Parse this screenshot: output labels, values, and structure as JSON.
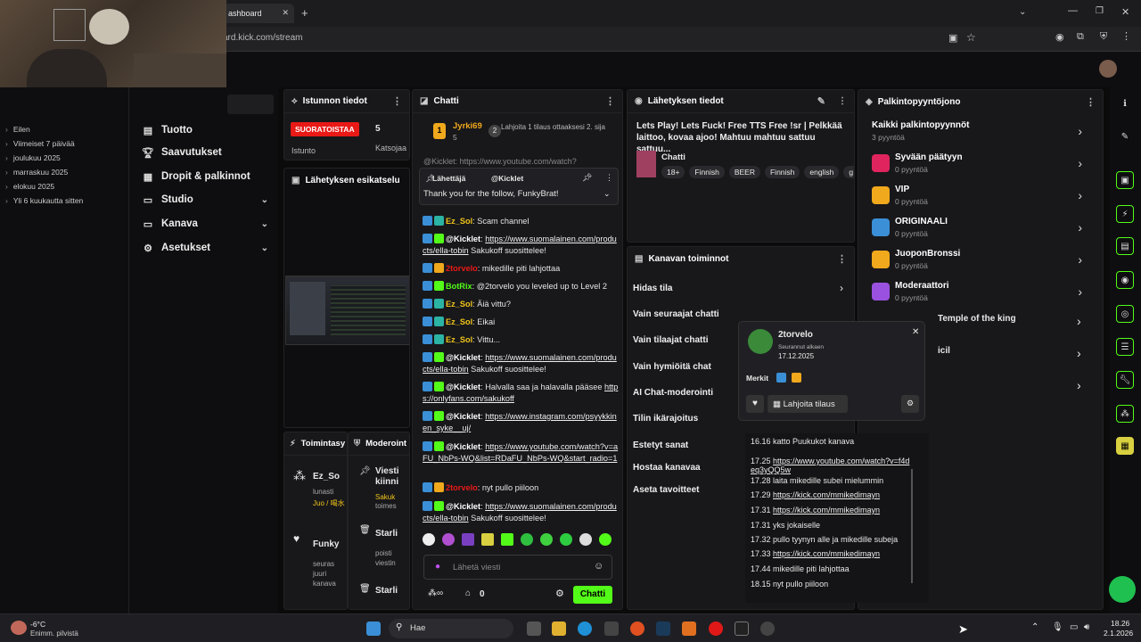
{
  "browser": {
    "tab_title": "ashboard",
    "url": "ard.kick.com/stream"
  },
  "history": [
    "Eilen",
    "Viimeiset 7 päivää",
    "joulukuu 2025",
    "marraskuu 2025",
    "elokuu 2025",
    "Yli 6 kuukautta sitten"
  ],
  "sidenav": {
    "items": [
      {
        "label": "Tuotto",
        "icon": "chart-icon"
      },
      {
        "label": "Saavutukset",
        "icon": "trophy-icon"
      },
      {
        "label": "Dropit & palkinnot",
        "icon": "gift-icon"
      },
      {
        "label": "Studio",
        "icon": "video-icon"
      },
      {
        "label": "Kanava",
        "icon": "broadcast-icon"
      },
      {
        "label": "Asetukset",
        "icon": "gear-icon"
      }
    ]
  },
  "session": {
    "title": "Istunnon tiedot",
    "live_badge": "SUORATOISTAA",
    "viewers": "5",
    "duration_label": "Istunto",
    "watching_label": "Katsojaa"
  },
  "preview": {
    "title": "Lähetyksen esikatselu"
  },
  "actions_panel": {
    "title": "Toimintasy"
  },
  "mod_panel": {
    "title": "Moderoint"
  },
  "activity": [
    {
      "user": "Ez_So",
      "sub": "lunasti",
      "extra": "Juo / 喝水"
    },
    {
      "user": "Viesti kiinni",
      "sub": "Sakuk",
      "extra": "toimes"
    },
    {
      "user": "Funky",
      "sub": "seuras juuri kanava"
    },
    {
      "user": "Starli",
      "sub": "poisti viestin"
    },
    {
      "user": "Starli",
      "sub": ""
    }
  ],
  "chat": {
    "title": "Chatti",
    "top_gifter": "Jyrki69",
    "top_gifter_count": "5",
    "gift_prompt": "Lahjoita 1 tilaus ottaaksesi 2. sija",
    "pinned_sender": "Lähettäjä",
    "pinned_user": "@Kicklet",
    "pinned_text": "Thank you for the follow, FunkyBrat!",
    "ghost_line": "@Kicklet: https://www.youtube.com/watch?",
    "messages": [
      {
        "user": "Ez_Sol",
        "color": "#f0c419",
        "text": ": Scam channel"
      },
      {
        "user": "@Kicklet",
        "color": "#ffffff",
        "text": ":",
        "link": "https://www.suomalainen.com/products/ella-tobin",
        "after": " Sakukoff suosittelee!"
      },
      {
        "user": "2torvelo",
        "color": "#e91916",
        "text": ": mikedille piti lahjottaa"
      },
      {
        "user": "BotRix",
        "color": "#53fc18",
        "text": ": @2torvelo you leveled up to Level 2"
      },
      {
        "user": "Ez_Sol",
        "color": "#f0c419",
        "text": ": Äiä vittu?"
      },
      {
        "user": "Ez_Sol",
        "color": "#f0c419",
        "text": ": Eikai"
      },
      {
        "user": "Ez_Sol",
        "color": "#f0c419",
        "text": ": Vittu..."
      },
      {
        "user": "@Kicklet",
        "color": "#ffffff",
        "text": ":",
        "link": "https://www.suomalainen.com/products/ella-tobin",
        "after": " Sakukoff suosittelee!"
      },
      {
        "user": "@Kicklet",
        "color": "#ffffff",
        "text": ": Halvalla saa ja halavalla pääsee",
        "link": "https://onlyfans.com/sakukoff",
        "after": ""
      },
      {
        "user": "@Kicklet",
        "color": "#ffffff",
        "text": ":",
        "link": "https://www.instagram.com/psyykkinen_syke__uj/",
        "after": ""
      },
      {
        "user": "@Kicklet",
        "color": "#ffffff",
        "text": ":",
        "link": "https://www.youtube.com/watch?v=aFU_NbPs-WQ&list=RDaFU_NbPs-WQ&start_radio=1",
        "after": ""
      },
      {
        "user": "2torvelo",
        "color": "#e91916",
        "text": ": nyt pullo piiloon"
      },
      {
        "user": "@Kicklet",
        "color": "#ffffff",
        "text": ":",
        "link": "https://www.suomalainen.com/products/ella-tobin",
        "after": " Sakukoff suosittelee!"
      }
    ],
    "input_placeholder": "Lähetä viesti",
    "points": "0",
    "send_label": "Chatti"
  },
  "stream_info": {
    "title": "Lähetyksen tiedot",
    "stream_title": "Lets Play! Lets Fuck! Free TTS Free !sr | Pelkkää laittoo, kovaa ajoo! Mahtuu mahtuu sattuu sattuu...",
    "category": "Chatti",
    "tags": [
      "18+",
      "Finnish",
      "BEER",
      "Finnish",
      "english",
      "g"
    ]
  },
  "channel_actions": {
    "title": "Kanavan toiminnot",
    "items": [
      "Hidas tila",
      "Vain seuraajat chatti",
      "Vain tilaajat chatti",
      "Vain hymiöitä chat",
      "AI Chat-moderointi",
      "Tilin ikärajoitus",
      "Estetyt sanat",
      "Hostaa kanavaa",
      "Aseta tavoitteet"
    ]
  },
  "rewards": {
    "title": "Palkintopyyntöjono",
    "items": [
      {
        "title": "Kaikki palkintopyynnöt",
        "sub": "3 pyyntöä",
        "color": ""
      },
      {
        "title": "Syvään päätyyn",
        "sub": "0 pyyntöä",
        "color": "#e0245e"
      },
      {
        "title": "VIP",
        "sub": "0 pyyntöä",
        "color": "#f0a81c"
      },
      {
        "title": "ORIGINAALI",
        "sub": "0 pyyntöä",
        "color": "#3a8fd6"
      },
      {
        "title": "JuoponBronssi",
        "sub": "0 pyyntöä",
        "color": "#f0a81c"
      },
      {
        "title": "Moderaattori",
        "sub": "0 pyyntöä",
        "color": "#9b51e0"
      },
      {
        "title": "Temple of the king",
        "sub": "",
        "color": ""
      },
      {
        "title": "icil",
        "sub": "",
        "color": ""
      }
    ]
  },
  "user_popup": {
    "name": "2torvelo",
    "follow_label": "Seurannut alkaen",
    "follow_date": "17.12.2025",
    "badges_label": "Merkit",
    "gift_button": "Lahjoita tilaus"
  },
  "log": [
    {
      "time": "16.16",
      "text": "katto Puukukot kanava"
    },
    {
      "time": "17.25",
      "link": "https://www.youtube.com/watch?v=f4deq3yQQ5w"
    },
    {
      "time": "17.28",
      "text": "laita mikedille subei mielummin"
    },
    {
      "time": "17.29",
      "link": "https://kick.com/mmikedimayn"
    },
    {
      "time": "17.31",
      "link": "https://kick.com/mmikedimayn"
    },
    {
      "time": "17.31",
      "text": "yks jokaiselle"
    },
    {
      "time": "17.32",
      "text": "pullo tyynyn alle ja mikedille subeja"
    },
    {
      "time": "17.33",
      "link": "https://kick.com/mmikedimayn"
    },
    {
      "time": "17.44",
      "text": "mikedille piti lahjottaa"
    },
    {
      "time": "18.15",
      "text": "nyt pullo piiloon"
    }
  ],
  "taskbar": {
    "weather_temp": "-6°C",
    "weather_desc": "Enimm. pilvistä",
    "search_label": "Hae",
    "time": "18.26",
    "date": "2.1.2026"
  },
  "colors": {
    "accent": "#53fc18",
    "panel": "#18181b",
    "live": "#e91916"
  }
}
